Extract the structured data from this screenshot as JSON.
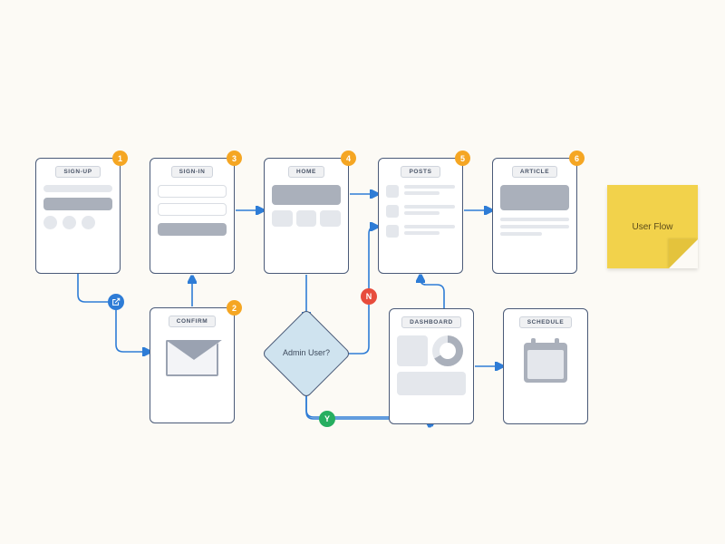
{
  "title": "User Flow",
  "nodes": {
    "signup": {
      "label": "SIGN-UP",
      "badge": "1"
    },
    "confirm": {
      "label": "CONFIRM",
      "badge": "2"
    },
    "signin": {
      "label": "SIGN-IN",
      "badge": "3"
    },
    "home": {
      "label": "HOME",
      "badge": "4"
    },
    "posts": {
      "label": "POSTS",
      "badge": "5"
    },
    "article": {
      "label": "ARTICLE",
      "badge": "6"
    },
    "dashboard": {
      "label": "DASHBOARD"
    },
    "schedule": {
      "label": "SCHEDULE"
    }
  },
  "decision": {
    "label": "Admin User?"
  },
  "edge_labels": {
    "no": "N",
    "yes": "Y"
  },
  "sticky_note": {
    "text": "User Flow"
  },
  "edges": [
    {
      "from": "signup",
      "to": "confirm",
      "via": "bottom-right-down"
    },
    {
      "from": "confirm",
      "to": "signin",
      "via": "up"
    },
    {
      "from": "signin",
      "to": "home",
      "via": "right"
    },
    {
      "from": "home",
      "to": "posts",
      "via": "right"
    },
    {
      "from": "posts",
      "to": "article",
      "via": "right"
    },
    {
      "from": "home",
      "to": "decision",
      "via": "down"
    },
    {
      "from": "decision",
      "to": "posts",
      "label": "no",
      "via": "up-right"
    },
    {
      "from": "decision",
      "to": "dashboard",
      "label": "yes",
      "via": "right"
    },
    {
      "from": "dashboard",
      "to": "posts",
      "via": "up"
    },
    {
      "from": "dashboard",
      "to": "schedule",
      "via": "right"
    }
  ],
  "colors": {
    "page_bg": "#fcfaf5",
    "card_border": "#4a5a78",
    "connector": "#2e7cd6",
    "badge": "#f5a623",
    "decision_fill": "#cfe3ef",
    "sticky": "#f2d24b",
    "no": "#e74c3c",
    "yes": "#27ae60"
  }
}
